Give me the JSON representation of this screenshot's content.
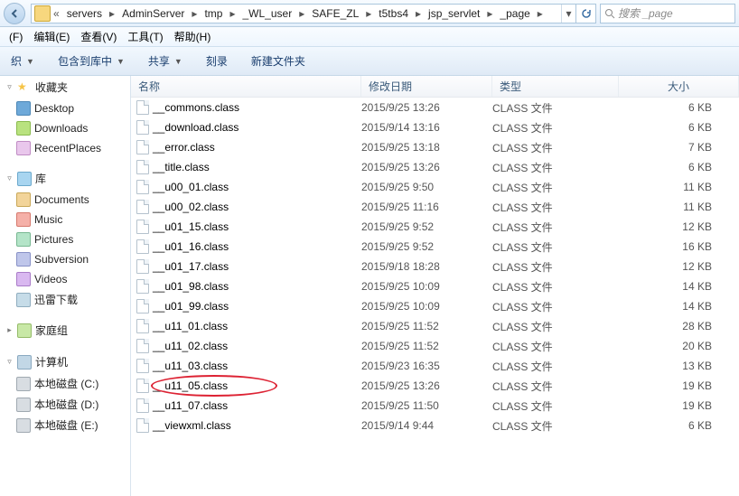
{
  "breadcrumb": {
    "prefix": "«",
    "items": [
      "servers",
      "AdminServer",
      "tmp",
      "_WL_user",
      "SAFE_ZL",
      "t5tbs4",
      "jsp_servlet",
      "_page"
    ]
  },
  "search": {
    "placeholder": "搜索 _page"
  },
  "menu": {
    "file": "(F)",
    "edit": "编辑(E)",
    "view": "查看(V)",
    "tools": "工具(T)",
    "help": "帮助(H)"
  },
  "toolbar": {
    "organize": "织",
    "include": "包含到库中",
    "share": "共享",
    "burn": "刻录",
    "newfolder": "新建文件夹"
  },
  "nav": {
    "favorites": "收藏夹",
    "desktop": "Desktop",
    "downloads": "Downloads",
    "recent": "RecentPlaces",
    "libraries": "库",
    "documents": "Documents",
    "music": "Music",
    "pictures": "Pictures",
    "subversion": "Subversion",
    "videos": "Videos",
    "xunlei": "迅雷下载",
    "homegroup": "家庭组",
    "computer": "计算机",
    "driveC": "本地磁盘 (C:)",
    "driveD": "本地磁盘 (D:)",
    "driveE": "本地磁盘 (E:)"
  },
  "columns": {
    "name": "名称",
    "date": "修改日期",
    "type": "类型",
    "size": "大小"
  },
  "files": [
    {
      "name": "__commons.class",
      "date": "2015/9/25 13:26",
      "type": "CLASS 文件",
      "size": "6 KB"
    },
    {
      "name": "__download.class",
      "date": "2015/9/14 13:16",
      "type": "CLASS 文件",
      "size": "6 KB"
    },
    {
      "name": "__error.class",
      "date": "2015/9/25 13:18",
      "type": "CLASS 文件",
      "size": "7 KB"
    },
    {
      "name": "__title.class",
      "date": "2015/9/25 13:26",
      "type": "CLASS 文件",
      "size": "6 KB"
    },
    {
      "name": "__u00_01.class",
      "date": "2015/9/25 9:50",
      "type": "CLASS 文件",
      "size": "11 KB"
    },
    {
      "name": "__u00_02.class",
      "date": "2015/9/25 11:16",
      "type": "CLASS 文件",
      "size": "11 KB"
    },
    {
      "name": "__u01_15.class",
      "date": "2015/9/25 9:52",
      "type": "CLASS 文件",
      "size": "12 KB"
    },
    {
      "name": "__u01_16.class",
      "date": "2015/9/25 9:52",
      "type": "CLASS 文件",
      "size": "16 KB"
    },
    {
      "name": "__u01_17.class",
      "date": "2015/9/18 18:28",
      "type": "CLASS 文件",
      "size": "12 KB"
    },
    {
      "name": "__u01_98.class",
      "date": "2015/9/25 10:09",
      "type": "CLASS 文件",
      "size": "14 KB"
    },
    {
      "name": "__u01_99.class",
      "date": "2015/9/25 10:09",
      "type": "CLASS 文件",
      "size": "14 KB"
    },
    {
      "name": "__u11_01.class",
      "date": "2015/9/25 11:52",
      "type": "CLASS 文件",
      "size": "28 KB"
    },
    {
      "name": "__u11_02.class",
      "date": "2015/9/25 11:52",
      "type": "CLASS 文件",
      "size": "20 KB"
    },
    {
      "name": "__u11_03.class",
      "date": "2015/9/23 16:35",
      "type": "CLASS 文件",
      "size": "13 KB"
    },
    {
      "name": "__u11_05.class",
      "date": "2015/9/25 13:26",
      "type": "CLASS 文件",
      "size": "19 KB",
      "circled": true
    },
    {
      "name": "__u11_07.class",
      "date": "2015/9/25 11:50",
      "type": "CLASS 文件",
      "size": "19 KB"
    },
    {
      "name": "__viewxml.class",
      "date": "2015/9/14 9:44",
      "type": "CLASS 文件",
      "size": "6 KB"
    }
  ]
}
